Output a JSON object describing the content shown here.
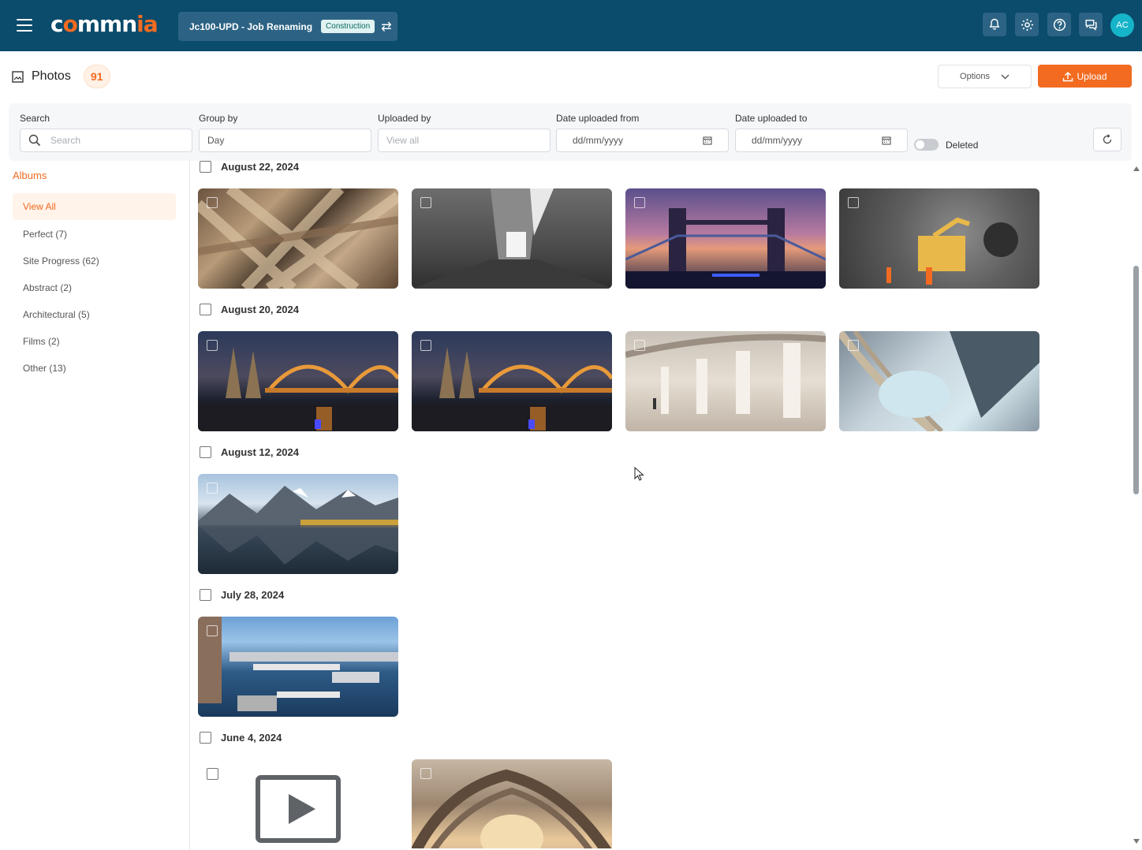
{
  "header": {
    "logo_text": "commnia",
    "job_title": "Jc100-UPD - Job Renaming",
    "job_badge": "Construction",
    "avatar_initials": "AC",
    "brand_color": "#0b4b6b",
    "accent_color": "#f26b21",
    "icons": [
      "bell-icon",
      "gear-icon",
      "help-icon",
      "chat-icon"
    ]
  },
  "page": {
    "title": "Photos",
    "count": "91",
    "options_label": "Options",
    "upload_label": "Upload"
  },
  "filters": {
    "search_label": "Search",
    "search_placeholder": "Search",
    "group_by_label": "Group by",
    "group_by_value": "Day",
    "uploaded_by_label": "Uploaded by",
    "uploaded_by_placeholder": "View all",
    "date_from_label": "Date uploaded from",
    "date_from_placeholder": "dd/mm/yyyy",
    "date_to_label": "Date uploaded to",
    "date_to_placeholder": "dd/mm/yyyy",
    "deleted_label": "Deleted",
    "deleted_on": false
  },
  "sidebar": {
    "title": "Albums",
    "items": [
      {
        "label": "View All",
        "active": true
      },
      {
        "label": "Perfect (7)",
        "active": false
      },
      {
        "label": "Site Progress (62)",
        "active": false
      },
      {
        "label": "Abstract (2)",
        "active": false
      },
      {
        "label": "Architectural (5)",
        "active": false
      },
      {
        "label": "Films (2)",
        "active": false
      },
      {
        "label": "Other (13)",
        "active": false
      }
    ]
  },
  "groups": [
    {
      "date": "August 22, 2024",
      "photos": [
        "wooden-beams-photo",
        "concrete-corridor-photo",
        "tower-bridge-photo",
        "tunnel-machinery-photo"
      ]
    },
    {
      "date": "August 20, 2024",
      "photos": [
        "cologne-bridge-photo",
        "cologne-bridge-photo",
        "colonnade-photo",
        "glass-tower-photo"
      ]
    },
    {
      "date": "August 12, 2024",
      "photos": [
        "mountain-lake-photo"
      ]
    },
    {
      "date": "July 28, 2024",
      "photos": [
        "harbor-city-photo"
      ]
    },
    {
      "date": "June 4, 2024",
      "photos": [
        "video-placeholder",
        "tree-tunnel-photo"
      ]
    }
  ]
}
